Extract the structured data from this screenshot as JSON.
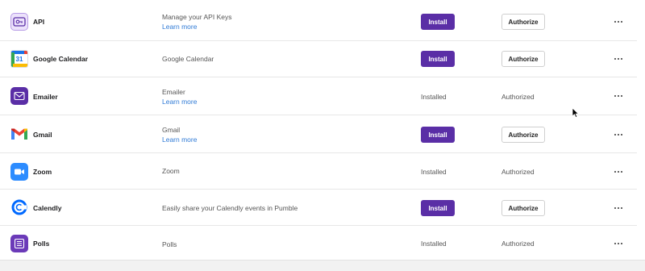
{
  "integrations": [
    {
      "name": "API",
      "icon": "api-icon",
      "desc": "Manage your API Keys",
      "learn_more": "Learn more",
      "install": "Install",
      "authorize": "Authorize"
    },
    {
      "name": "Google Calendar",
      "icon": "google-calendar-icon",
      "icon_text": "31",
      "desc": "Google Calendar",
      "install": "Install",
      "authorize": "Authorize"
    },
    {
      "name": "Emailer",
      "icon": "emailer-icon",
      "desc": "Emailer",
      "learn_more": "Learn more",
      "installed": "Installed",
      "authorized": "Authorized"
    },
    {
      "name": "Gmail",
      "icon": "gmail-icon",
      "desc": "Gmail",
      "learn_more": "Learn more",
      "install": "Install",
      "authorize": "Authorize"
    },
    {
      "name": "Zoom",
      "icon": "zoom-icon",
      "desc": "Zoom",
      "installed": "Installed",
      "authorized": "Authorized"
    },
    {
      "name": "Calendly",
      "icon": "calendly-icon",
      "desc": "Easily share your Calendly events in Pumble",
      "install": "Install",
      "authorize": "Authorize"
    },
    {
      "name": "Polls",
      "icon": "polls-icon",
      "desc": "Polls",
      "installed": "Installed",
      "authorized": "Authorized"
    }
  ],
  "colors": {
    "install_button": "#5a2ea6",
    "link": "#2f7ad6",
    "api_icon_bg": "#ece2fb",
    "emailer_icon_bg": "#5a2ea6",
    "zoom_icon_bg": "#2d8cff",
    "calendly_icon": "#0069ff",
    "polls_icon_bg": "#6b3ab8"
  }
}
